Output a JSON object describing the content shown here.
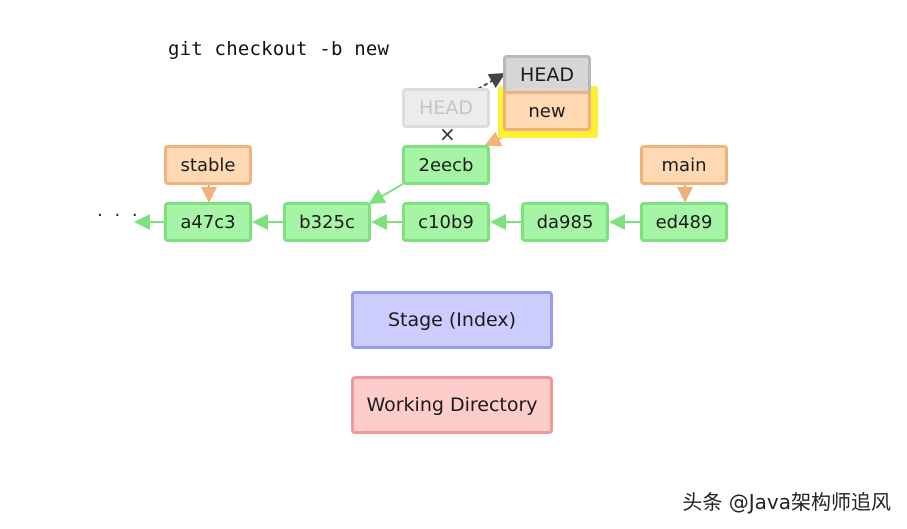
{
  "command": "git checkout -b new",
  "commits": [
    {
      "id": "a47c3"
    },
    {
      "id": "b325c"
    },
    {
      "id": "c10b9"
    },
    {
      "id": "da985"
    },
    {
      "id": "ed489"
    },
    {
      "id": "2eecb"
    }
  ],
  "branches": {
    "stable": "stable",
    "main": "main",
    "new": "new"
  },
  "head": {
    "current": "HEAD",
    "previous": "HEAD"
  },
  "history_ellipsis": "· · ·",
  "detached_marker": "×",
  "areas": {
    "stage": "Stage (Index)",
    "working_directory": "Working Directory"
  },
  "watermark": "头条 @Java架构师追风",
  "colors": {
    "commit_fill": "#a6f5a6",
    "commit_border": "#7ee07e",
    "branch_fill": "#ffd9b3",
    "branch_border": "#f0b27d",
    "head_fill": "#d6d6d6",
    "highlight": "#fff033",
    "stage_fill": "#ccccff",
    "workdir_fill": "#ffcccc"
  }
}
